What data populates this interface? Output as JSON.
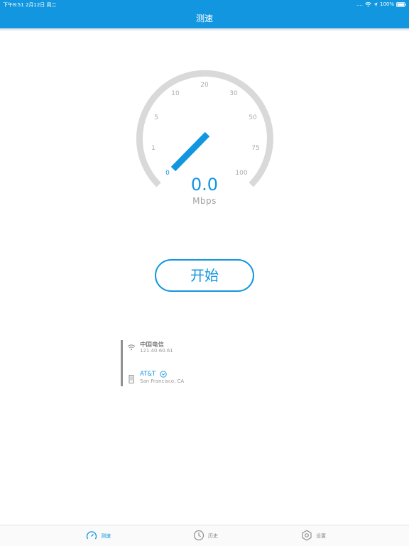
{
  "status_bar": {
    "time_date": "下午8:51   2月12日 周二",
    "signal": "....",
    "battery": "100%"
  },
  "header": {
    "title": "测速"
  },
  "gauge": {
    "ticks": [
      "0",
      "1",
      "5",
      "10",
      "20",
      "30",
      "50",
      "75",
      "100"
    ],
    "needle_value": 0,
    "speed": "0.0",
    "unit": "Mbps",
    "colors": {
      "accent": "#1296e0",
      "track": "#d9d9d9",
      "tick_text": "#a9abad"
    }
  },
  "start_button": {
    "label": "开始"
  },
  "network": {
    "carrier": "中国电信",
    "ip": "121.40.60.61",
    "isp": "AT&T",
    "location": "San Francisco, CA"
  },
  "tabbar": {
    "tabs": [
      {
        "label": "测速",
        "icon": "speedometer-icon",
        "active": true
      },
      {
        "label": "历史",
        "icon": "history-clock-icon",
        "active": false
      },
      {
        "label": "设置",
        "icon": "settings-hexagon-icon",
        "active": false
      }
    ]
  }
}
